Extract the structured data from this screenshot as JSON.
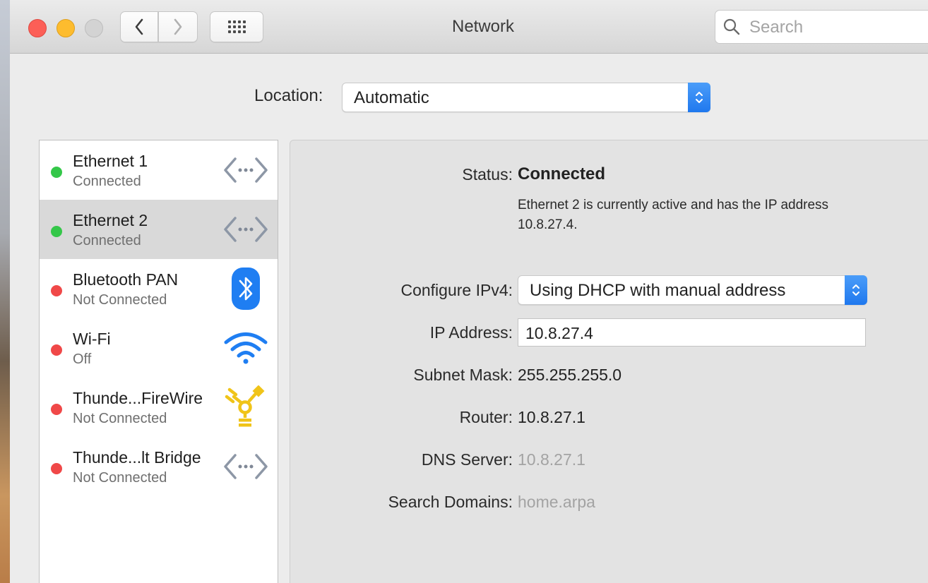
{
  "window": {
    "title": "Network",
    "search_placeholder": "Search"
  },
  "location": {
    "label": "Location:",
    "value": "Automatic"
  },
  "services": [
    {
      "name": "Ethernet 1",
      "status": "Connected",
      "dot_color": "#34c749",
      "icon": "ethernet-icon",
      "selected": false
    },
    {
      "name": "Ethernet 2",
      "status": "Connected",
      "dot_color": "#34c749",
      "icon": "ethernet-icon",
      "selected": true
    },
    {
      "name": "Bluetooth PAN",
      "status": "Not Connected",
      "dot_color": "#f04848",
      "icon": "bluetooth-icon",
      "selected": false
    },
    {
      "name": "Wi-Fi",
      "status": "Off",
      "dot_color": "#f04848",
      "icon": "wifi-icon",
      "selected": false
    },
    {
      "name": "Thunde...FireWire",
      "status": "Not Connected",
      "dot_color": "#f04848",
      "icon": "firewire-icon",
      "selected": false
    },
    {
      "name": "Thunde...lt Bridge",
      "status": "Not Connected",
      "dot_color": "#f04848",
      "icon": "ethernet-icon",
      "selected": false
    }
  ],
  "detail": {
    "status_label": "Status:",
    "status_value": "Connected",
    "status_description": "Ethernet 2 is currently active and has the IP address 10.8.27.4.",
    "configure_label": "Configure IPv4:",
    "configure_value": "Using DHCP with manual address",
    "ip_label": "IP Address:",
    "ip_value": "10.8.27.4",
    "subnet_label": "Subnet Mask:",
    "subnet_value": "255.255.255.0",
    "router_label": "Router:",
    "router_value": "10.8.27.1",
    "dns_label": "DNS Server:",
    "dns_value": "10.8.27.1",
    "search_domains_label": "Search Domains:",
    "search_domains_value": "home.arpa"
  },
  "colors": {
    "accent": "#1f78ee",
    "connected": "#34c749",
    "disconnected": "#f04848"
  }
}
